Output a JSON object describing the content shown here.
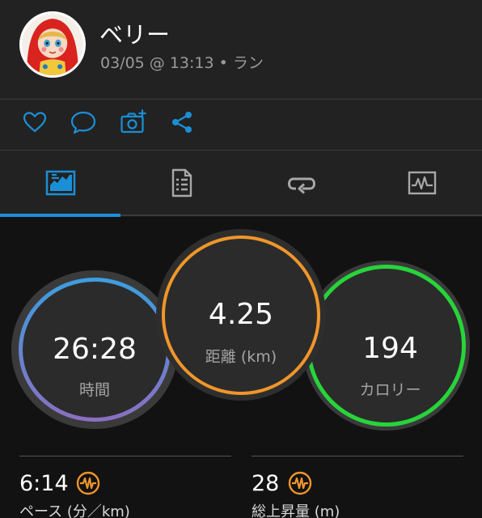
{
  "activity": {
    "user_name": "ベリー",
    "meta": "03/05 @ 13:13 • ラン"
  },
  "actions": [
    {
      "name": "like-button",
      "icon": "heart-icon"
    },
    {
      "name": "comment-button",
      "icon": "comment-icon"
    },
    {
      "name": "add-photo-button",
      "icon": "camera-plus-icon"
    },
    {
      "name": "share-button",
      "icon": "share-icon"
    }
  ],
  "tabs": [
    {
      "name": "tab-overview",
      "icon": "overview-chart-icon",
      "selected": true
    },
    {
      "name": "tab-details",
      "icon": "document-list-icon",
      "selected": false
    },
    {
      "name": "tab-laps",
      "icon": "laps-loop-icon",
      "selected": false
    },
    {
      "name": "tab-charts",
      "icon": "activity-graph-icon",
      "selected": false
    }
  ],
  "rings": {
    "time": {
      "value": "26:28",
      "label": "時間"
    },
    "distance": {
      "value": "4.25",
      "label": "距離 (km)"
    },
    "calories": {
      "value": "194",
      "label": "カロリー"
    }
  },
  "stats": [
    {
      "value": "6:14",
      "label": "ペース (分／km)",
      "icon": "performance-wave-icon"
    },
    {
      "value": "28",
      "label": "総上昇量 (m)",
      "icon": "performance-wave-icon"
    }
  ],
  "colors": {
    "accent_blue": "#1b8fd6",
    "time_ring_top": "#3b9ee0",
    "time_ring_bottom": "#8b6fc0",
    "distance_ring": "#f0962a",
    "calories_ring": "#27d43a",
    "stat_icon": "#f0962a"
  }
}
